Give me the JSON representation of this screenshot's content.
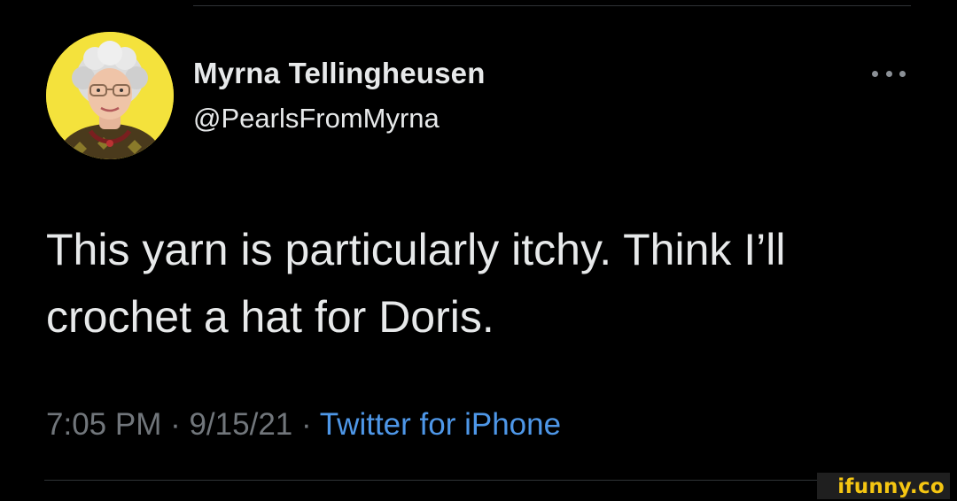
{
  "tweet": {
    "display_name": "Myrna Tellingheusen",
    "handle": "@PearlsFromMyrna",
    "more_icon": "more-horizontal-icon",
    "text": "This yarn is particularly itchy. Think I’ll crochet a hat for Doris.",
    "time": "7:05 PM",
    "separator": " · ",
    "date": "9/15/21",
    "source": "Twitter for iPhone"
  },
  "watermark": {
    "text": "ifunny.co"
  },
  "colors": {
    "background": "#000000",
    "primary_text": "#e7e9ea",
    "secondary_text": "#71767b",
    "link": "#4e97e8",
    "avatar_bg": "#f4e23c",
    "watermark": "#f5c612"
  }
}
